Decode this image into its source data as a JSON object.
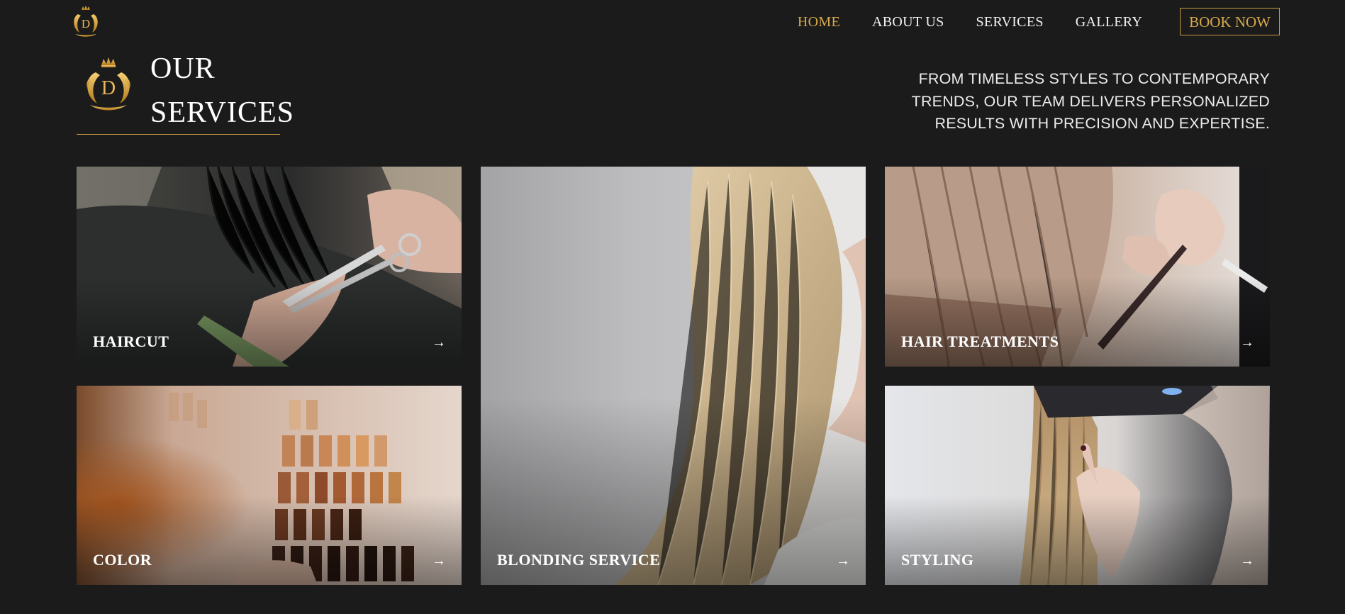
{
  "nav": {
    "logo_icon": "crest-logo-icon",
    "links": [
      {
        "label": "HOME",
        "active": true
      },
      {
        "label": "ABOUT US",
        "active": false
      },
      {
        "label": "SERVICES",
        "active": false
      },
      {
        "label": "GALLERY",
        "active": false
      }
    ],
    "book_label": "BOOK NOW"
  },
  "header": {
    "logo_icon": "crest-logo-icon",
    "title_line1": "OUR",
    "title_line2": "SERVICES",
    "tagline": "FROM TIMELESS STYLES TO CONTEMPORARY TRENDS, OUR TEAM DELIVERS PERSONALIZED RESULTS WITH PRECISION AND EXPERTISE."
  },
  "services": [
    {
      "label": "HAIRCUT",
      "arrow": "→",
      "photo": "haircut-photo"
    },
    {
      "label": "BLONDING SERVICE",
      "arrow": "→",
      "photo": "blonde-hair-photo"
    },
    {
      "label": "HAIR TREATMENTS",
      "arrow": "→",
      "photo": "hair-treatment-photo"
    },
    {
      "label": "COLOR",
      "arrow": "→",
      "photo": "color-swatch-photo"
    },
    {
      "label": "STYLING",
      "arrow": "→",
      "photo": "styling-photo"
    }
  ],
  "colors": {
    "background": "#1b1b1b",
    "accent_gold": "#d6a84a",
    "text": "#ffffff"
  }
}
